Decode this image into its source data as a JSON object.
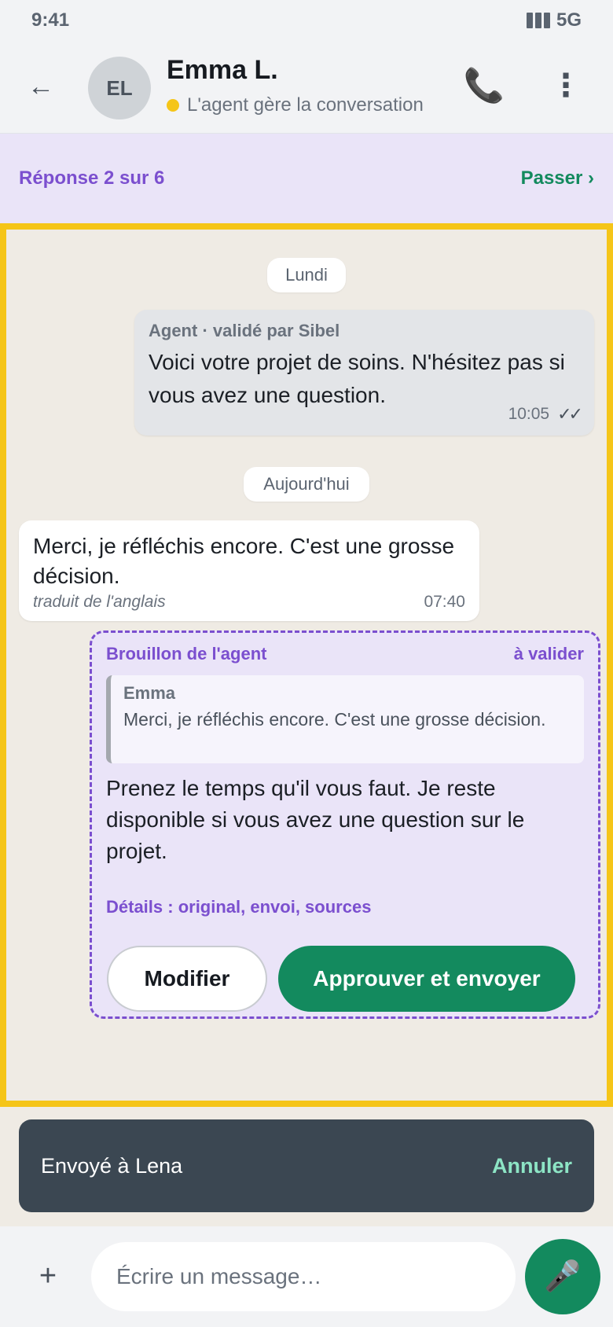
{
  "status_bar": {
    "time": "9:41",
    "network": "5G"
  },
  "header": {
    "back_icon": "←",
    "avatar_initials": "EL",
    "name": "Emma L.",
    "status_text": "L'agent gère la conversation",
    "status_color": "#f5c518",
    "phone_icon": "📞",
    "more_icon": "⋮"
  },
  "banner": {
    "count": "Réponse 2 sur 6",
    "skip": "Passer ›"
  },
  "chat": {
    "date_monday": "Lundi",
    "date_today": "Aujourd'hui",
    "agent_message": {
      "label": "Agent · validé par Sibel",
      "text": "Voici votre projet de soins. N'hésitez pas si vous avez une question.",
      "time": "10:05",
      "ticks": "✓✓"
    },
    "incoming_message": {
      "text": "Merci, je réfléchis encore. C'est une grosse décision.",
      "note": "traduit de l'anglais",
      "time": "07:40"
    },
    "draft": {
      "title": "Brouillon de l'agent",
      "status": "à valider",
      "quote_name": "Emma",
      "quote_text": "Merci, je réfléchis encore. C'est une grosse décision.",
      "text": "Prenez le temps qu'il vous faut. Je reste disponible si vous avez une question sur le projet.",
      "details": "Détails : original, envoi, sources",
      "modify_label": "Modifier",
      "approve_label": "Approuver et envoyer"
    }
  },
  "toast": {
    "text": "Envoyé à Lena",
    "undo": "Annuler"
  },
  "composer": {
    "plus_icon": "+",
    "placeholder": "Écrire un message…",
    "mic_icon": "🎤"
  },
  "colors": {
    "accent_purple": "#7b4fcf",
    "accent_green": "#138a5e",
    "highlight_yellow": "#f5c518"
  }
}
